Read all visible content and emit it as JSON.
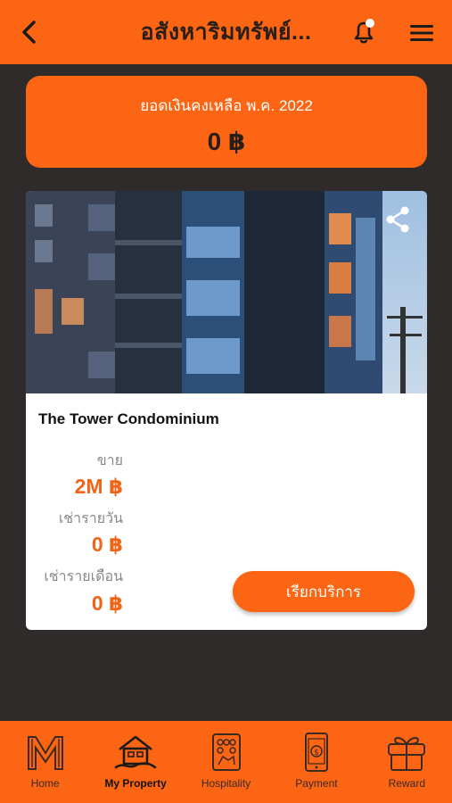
{
  "header": {
    "title": "อสังหาริมทรัพย์...",
    "back_icon": "chevron-left-icon",
    "notification_icon": "bell-icon",
    "menu_icon": "hamburger-menu-icon"
  },
  "balance": {
    "label": "ยอดเงินคงเหลือ พ.ค. 2022",
    "amount": "0 ฿"
  },
  "property": {
    "name": "The Tower Condominium",
    "share_icon": "share-icon",
    "stats": [
      {
        "label": "ขาย",
        "value": "2M ฿"
      },
      {
        "label": "เช่ารายวัน",
        "value": "0 ฿"
      },
      {
        "label": "เช่ารายเดือน",
        "value": "0 ฿"
      }
    ],
    "cta_label": "เรียกบริการ"
  },
  "nav": {
    "items": [
      {
        "label": "Home",
        "icon": "home-logo-icon",
        "active": false
      },
      {
        "label": "My Property",
        "icon": "house-icon",
        "active": true
      },
      {
        "label": "Hospitality",
        "icon": "hospitality-icon",
        "active": false
      },
      {
        "label": "Payment",
        "icon": "payment-phone-icon",
        "active": false
      },
      {
        "label": "Reward",
        "icon": "gift-icon",
        "active": false
      }
    ]
  },
  "colors": {
    "brand_orange": "#fb6513",
    "background": "#2f2b2b",
    "value_orange": "#f06418"
  }
}
